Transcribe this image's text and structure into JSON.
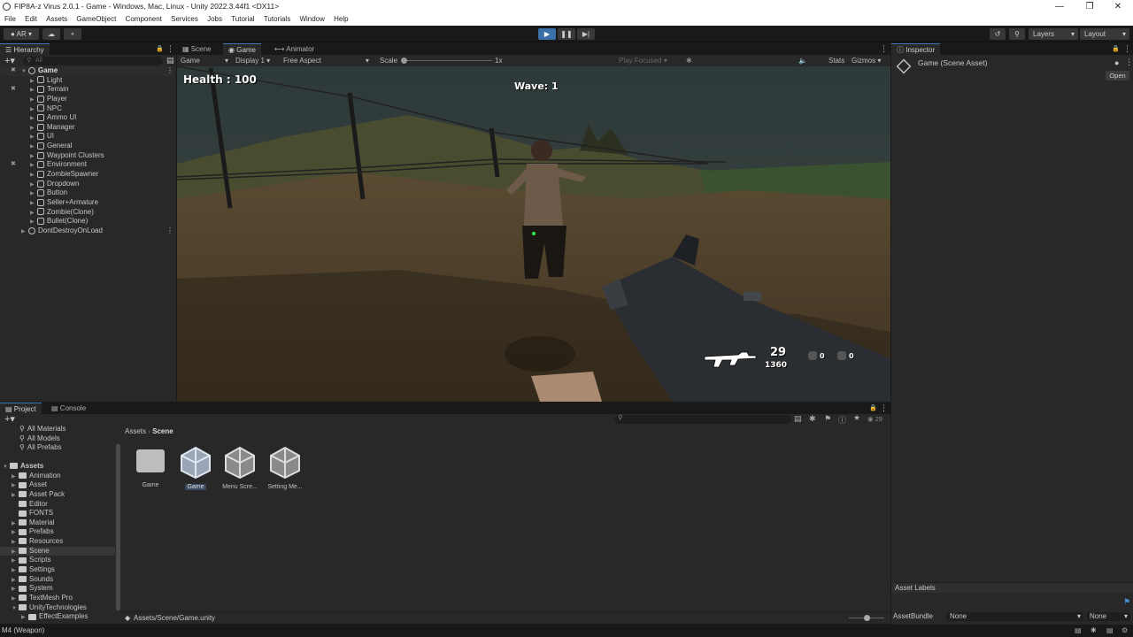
{
  "window": {
    "title": "FIP8A-z Virus 2.0.1 - Game - Windows, Mac, Linux - Unity 2022.3.44f1 <DX11>"
  },
  "menu": [
    "File",
    "Edit",
    "Assets",
    "GameObject",
    "Component",
    "Services",
    "Jobs",
    "Tutorial",
    "Tutorials",
    "Window",
    "Help"
  ],
  "toolbar": {
    "account": "AR",
    "layers": "Layers",
    "layout": "Layout"
  },
  "hierarchy": {
    "tab": "Hierarchy",
    "search_placeholder": "All",
    "root": "Game",
    "items": [
      "Light",
      "Terrain",
      "Player",
      "NPC",
      "Ammo UI",
      "Manager",
      "UI",
      "General",
      "Waypoint Clusters",
      "Environment",
      "ZombieSpawner",
      "Dropdown",
      "Button",
      "Seller+Armature",
      "Zombie(Clone)",
      "Bullet(Clone)"
    ],
    "dont_destroy": "DontDestroyOnLoad"
  },
  "viewport": {
    "tabs": [
      "Scene",
      "Game",
      "Animator"
    ],
    "game_label": "Game",
    "display": "Display 1",
    "aspect": "Free Aspect",
    "scale_label": "Scale",
    "scale_value": "1x",
    "play_focused": "Play Focused",
    "stats": "Stats",
    "gizmos": "Gizmos"
  },
  "hud": {
    "health": "Health : 100",
    "wave": "Wave: 1",
    "ammo_clip": "29",
    "ammo_total": "1360",
    "slot1": "0",
    "slot2": "0"
  },
  "inspector": {
    "tab": "Inspector",
    "title": "Game (Scene Asset)",
    "open_button": "Open",
    "asset_labels": "Asset Labels",
    "asset_bundle_label": "AssetBundle",
    "asset_bundle_value": "None",
    "variant_value": "None"
  },
  "project": {
    "tabs": [
      "Project",
      "Console"
    ],
    "favorites": [
      "All Materials",
      "All Models",
      "All Prefabs"
    ],
    "assets_root": "Assets",
    "folders": [
      "Animation",
      "Asset",
      "Asset Pack",
      "Editor",
      "FONTS",
      "Material",
      "Prefabs",
      "Resources",
      "Scene",
      "Scripts",
      "Settings",
      "Sounds",
      "System",
      "TextMesh Pro",
      "UnityTechnologies",
      "EffectExamples"
    ],
    "breadcrumb": [
      "Assets",
      "Scene"
    ],
    "items": [
      "Game",
      "Game",
      "Menu Scre...",
      "Setting Me..."
    ],
    "path": "Assets/Scene/Game.unity",
    "count": "29"
  },
  "status_bar": {
    "text": "M4 (Weapon)"
  }
}
